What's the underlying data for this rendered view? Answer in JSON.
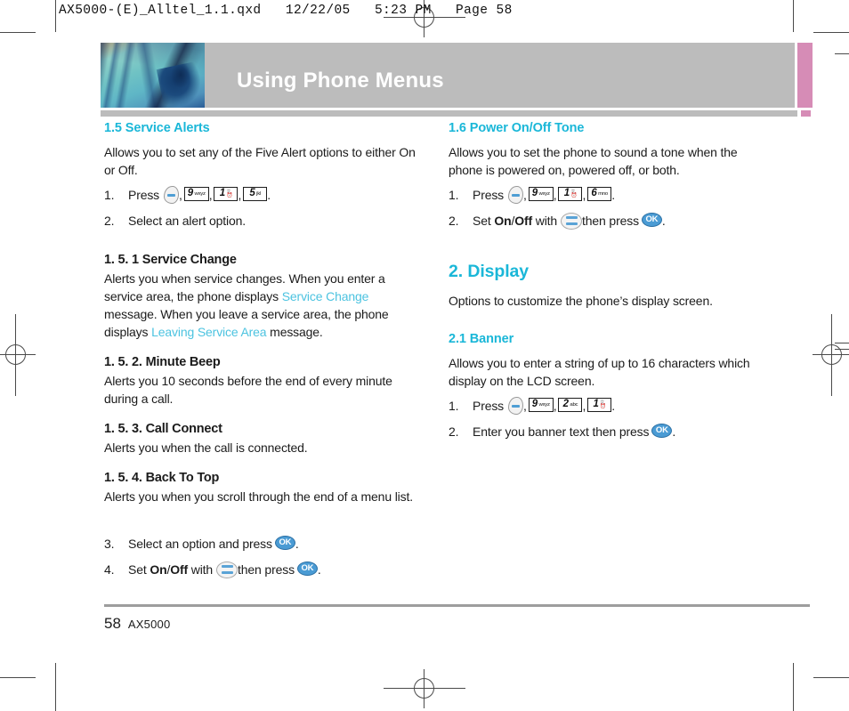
{
  "slug": "AX5000-(E)_Alltel_1.1.qxd   12/22/05   5:23 PM   Page 58",
  "header": {
    "title": "Using Phone Menus",
    "bar_color": "#bcbcbc",
    "accent_color": "#d68cb6"
  },
  "colors": {
    "heading_cyan": "#1ab7d8",
    "inline_cyan": "#4cc3e0",
    "body_text": "#1b1b1b",
    "key_blue": "#4a9bd4"
  },
  "left_column": {
    "s15_heading": "1.5 Service Alerts",
    "s15_intro": "Allows you to set any of the Five Alert options to either On or Off.",
    "s15_step1_num": "1.",
    "s15_step1_label": "Press",
    "s15_step1_keys": [
      "menu-key",
      "9wxyz",
      "1",
      "5jkl"
    ],
    "s15_step1_end": ".",
    "s15_step2_num": "2.",
    "s15_step2_text": "Select an alert option.",
    "s151_heading": "1. 5. 1 Service Change",
    "s151_body_a": "Alerts you when service changes. When you enter a service area, the phone displays ",
    "s151_cyan_a": "Service Change",
    "s151_body_b": " message. When you leave a service area, the phone displays ",
    "s151_cyan_b": "Leaving Service Area",
    "s151_body_c": " message.",
    "s152_heading": "1. 5. 2. Minute Beep",
    "s152_body": "Alerts you 10 seconds before the end of every minute during a call.",
    "s153_heading": "1. 5. 3. Call Connect",
    "s153_body": "Alerts you when the call is connected.",
    "s154_heading": "1. 5. 4. Back To Top",
    "s154_body": "Alerts you when you scroll through the end of a menu list.",
    "s15_step3_num": "3.",
    "s15_step3_text": "Select an option and press",
    "s15_step3_ok": "OK",
    "s15_step3_end": ".",
    "s15_step4_num": "4.",
    "s15_step4_pre": "Set",
    "s15_step4_on": "On",
    "s15_step4_slash": " / ",
    "s15_step4_off": "Off",
    "s15_step4_with": "with",
    "s15_step4_then": "then press",
    "s15_step4_ok": "OK",
    "s15_step4_end": "."
  },
  "right_column": {
    "s16_heading": "1.6 Power On/Off Tone",
    "s16_intro": "Allows you to set the phone to sound a tone when the phone is powered on, powered off, or both.",
    "s16_step1_num": "1.",
    "s16_step1_label": "Press",
    "s16_step1_keys": [
      "menu-key",
      "9wxyz",
      "1",
      "6mno"
    ],
    "s16_step1_end": ".",
    "s16_step2_num": "2.",
    "s16_step2_pre": "Set",
    "s16_step2_on": "On",
    "s16_step2_slash": " / ",
    "s16_step2_off": "Off",
    "s16_step2_with": "with",
    "s16_step2_then": "then press",
    "s16_step2_ok": "OK",
    "s16_step2_end": ".",
    "s2_heading": "2. Display",
    "s2_intro": "Options to customize the phone’s display screen.",
    "s21_heading": "2.1 Banner",
    "s21_intro": "Allows you to enter a string of up to 16 characters which display on the LCD screen.",
    "s21_step1_num": "1.",
    "s21_step1_label": "Press",
    "s21_step1_keys": [
      "menu-key",
      "9wxyz",
      "2abc",
      "1"
    ],
    "s21_step1_end": ".",
    "s21_step2_num": "2.",
    "s21_step2_text": "Enter you banner text then press",
    "s21_step2_ok": "OK",
    "s21_step2_end": "."
  },
  "keys": {
    "k9": {
      "digit": "9",
      "letters": "wxyz"
    },
    "k1": {
      "digit": "1",
      "letters": ""
    },
    "k5": {
      "digit": "5",
      "letters": "jkl"
    },
    "k6": {
      "digit": "6",
      "letters": "mno"
    },
    "k2": {
      "digit": "2",
      "letters": "abc"
    }
  },
  "footer": {
    "page_number": "58",
    "book": "AX5000"
  }
}
